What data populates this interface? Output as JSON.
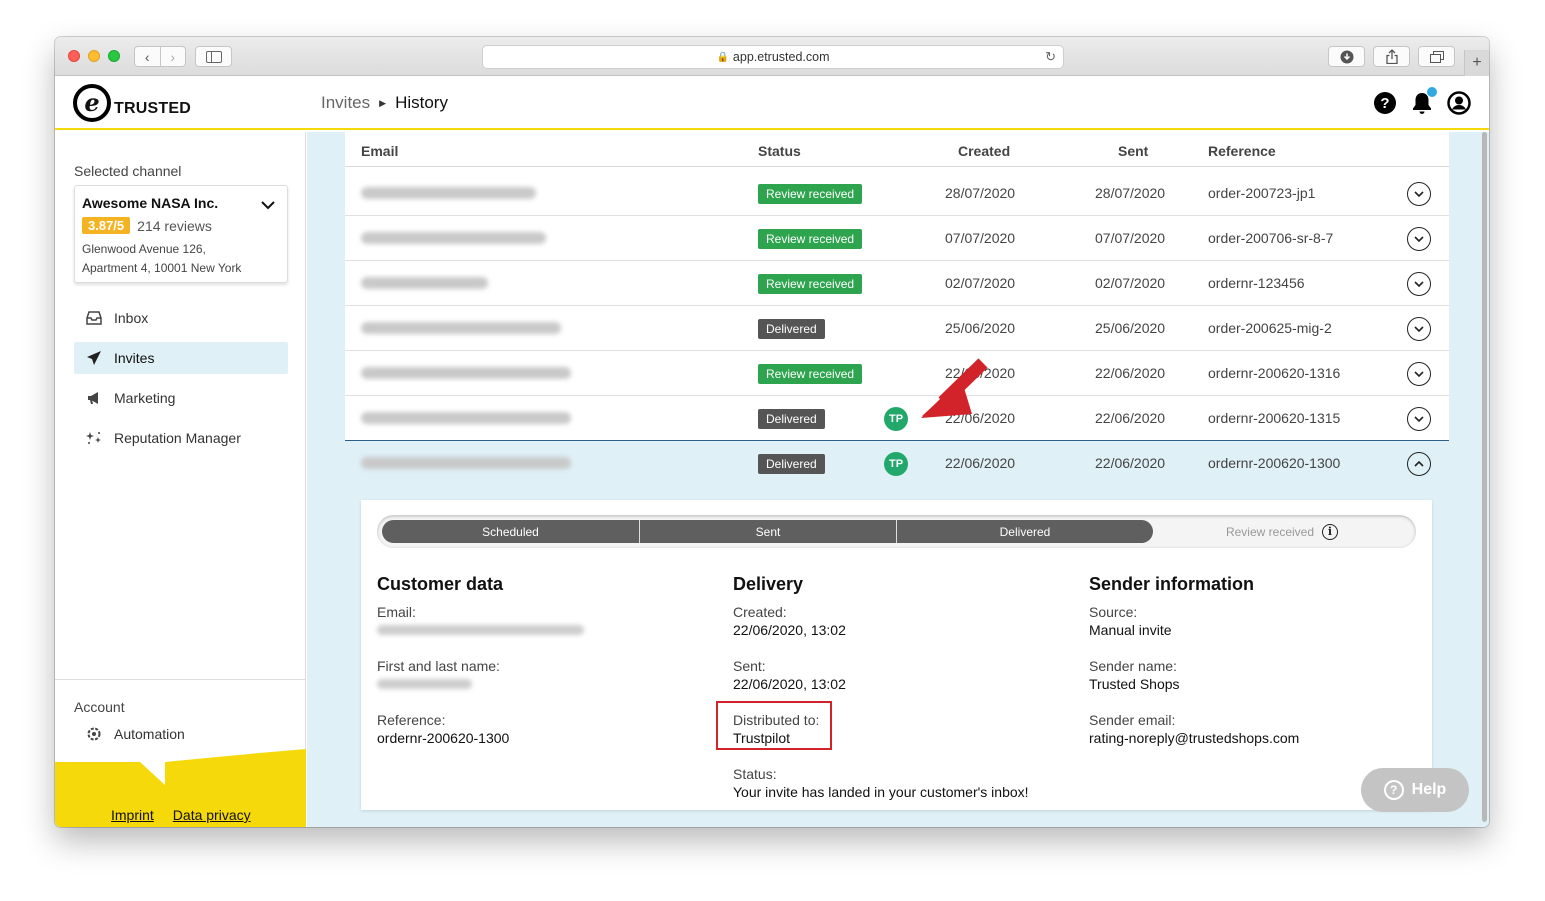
{
  "browser": {
    "url": "app.etrusted.com"
  },
  "app": {
    "logo_letter": "e",
    "logo_text": "TRUSTED"
  },
  "breadcrumb": {
    "parent": "Invites",
    "current": "History"
  },
  "sidebar": {
    "selected_channel_label": "Selected channel",
    "channel": {
      "name": "Awesome NASA Inc.",
      "rating": "3.87/5",
      "reviews": "214 reviews",
      "address_line1": "Glenwood Avenue 126,",
      "address_line2": "Apartment 4, 10001 New York"
    },
    "nav": [
      {
        "label": "Inbox",
        "icon": "inbox-icon",
        "active": false
      },
      {
        "label": "Invites",
        "icon": "paper-plane-icon",
        "active": true
      },
      {
        "label": "Marketing",
        "icon": "megaphone-icon",
        "active": false
      },
      {
        "label": "Reputation Manager",
        "icon": "sparkle-stars-icon",
        "active": false
      }
    ],
    "account_label": "Account",
    "automation_label": "Automation",
    "footer_links": {
      "imprint": "Imprint",
      "privacy": "Data privacy"
    }
  },
  "table": {
    "headers": {
      "email": "Email",
      "status": "Status",
      "created": "Created",
      "sent": "Sent",
      "reference": "Reference"
    },
    "rows": [
      {
        "status": "Review received",
        "tp": "",
        "created": "28/07/2020",
        "sent": "28/07/2020",
        "reference": "order-200723-jp1"
      },
      {
        "status": "Review received",
        "tp": "",
        "created": "07/07/2020",
        "sent": "07/07/2020",
        "reference": "order-200706-sr-8-7"
      },
      {
        "status": "Review received",
        "tp": "",
        "created": "02/07/2020",
        "sent": "02/07/2020",
        "reference": "ordernr-123456"
      },
      {
        "status": "Delivered",
        "tp": "",
        "created": "25/06/2020",
        "sent": "25/06/2020",
        "reference": "order-200625-mig-2"
      },
      {
        "status": "Review received",
        "tp": "",
        "created": "22/06/2020",
        "sent": "22/06/2020",
        "reference": "ordernr-200620-1316"
      },
      {
        "status": "Delivered",
        "tp": "TP",
        "created": "22/06/2020",
        "sent": "22/06/2020",
        "reference": "ordernr-200620-1315"
      },
      {
        "status": "Delivered",
        "tp": "TP",
        "created": "22/06/2020",
        "sent": "22/06/2020",
        "reference": "ordernr-200620-1300"
      }
    ]
  },
  "detail": {
    "steps": [
      "Scheduled",
      "Sent",
      "Delivered"
    ],
    "pending_step": "Review received",
    "customer": {
      "title": "Customer data",
      "email_label": "Email:",
      "name_label": "First and last name:",
      "reference_label": "Reference:",
      "reference": "ordernr-200620-1300"
    },
    "delivery": {
      "title": "Delivery",
      "created_label": "Created:",
      "created": "22/06/2020, 13:02",
      "sent_label": "Sent:",
      "sent": "22/06/2020, 13:02",
      "distributed_label": "Distributed to:",
      "distributed": "Trustpilot",
      "status_label": "Status:",
      "status": "Your invite has landed in your customer's inbox!"
    },
    "sender": {
      "title": "Sender information",
      "source_label": "Source:",
      "source": "Manual invite",
      "name_label": "Sender name:",
      "name": "Trusted Shops",
      "email_label": "Sender email:",
      "email": "rating-noreply@trustedshops.com"
    }
  },
  "help_label": "Help",
  "colors": {
    "accent_yellow": "#f5d90a",
    "review_green": "#2ea44f",
    "delivered_gray": "#555555",
    "tp_green": "#23a86b",
    "annotation_red": "#d2232a",
    "selection_blue": "#dff0f7"
  }
}
